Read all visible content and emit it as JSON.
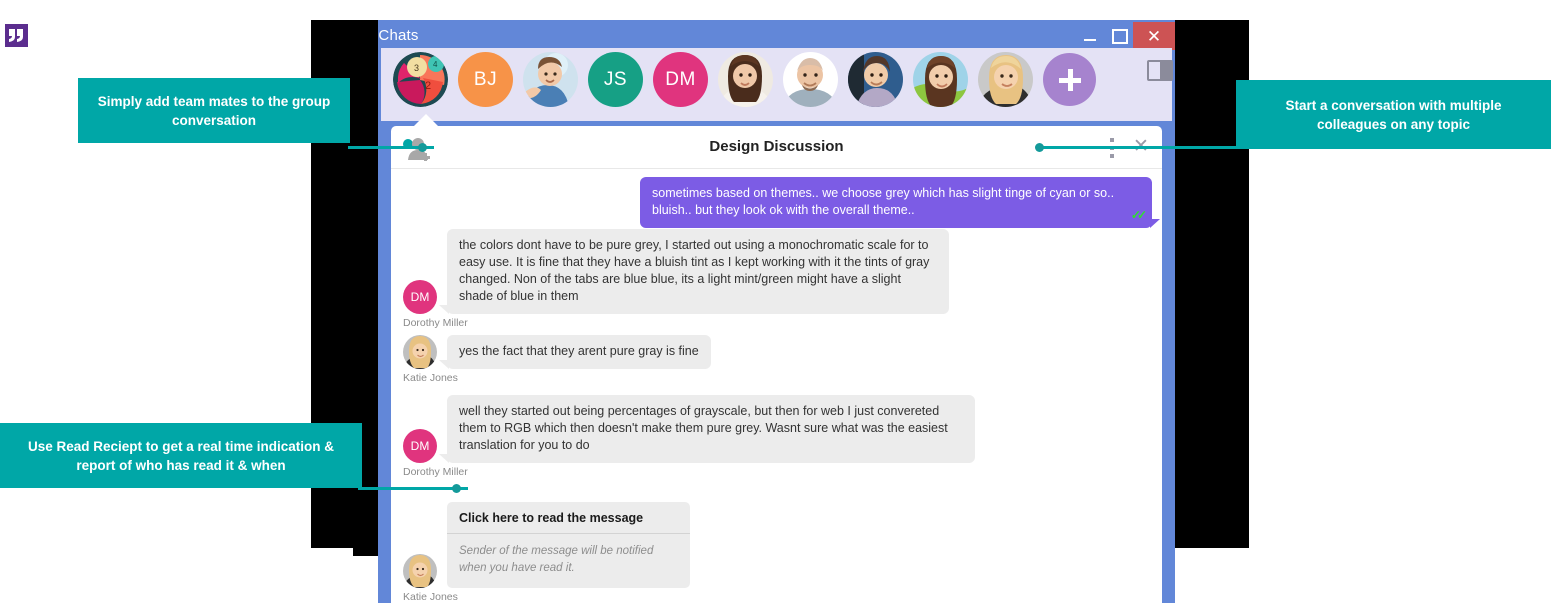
{
  "window": {
    "title": "Chats",
    "app_icon": "quote-icon",
    "controls": {
      "minimize": "–",
      "maximize": "□",
      "close": "✕"
    }
  },
  "contacts": {
    "items": [
      {
        "name": "group-avatar",
        "type": "group",
        "badges": [
          "3",
          "4",
          "2"
        ]
      },
      {
        "name": "BJ",
        "type": "initials",
        "color": "#f79348"
      },
      {
        "name": "photo-man-1",
        "type": "photo"
      },
      {
        "name": "JS",
        "type": "initials",
        "color": "#16a085"
      },
      {
        "name": "DM",
        "type": "initials",
        "color": "#e0347e"
      },
      {
        "name": "photo-woman-1",
        "type": "photo"
      },
      {
        "name": "photo-man-2",
        "type": "photo"
      },
      {
        "name": "photo-man-3",
        "type": "photo"
      },
      {
        "name": "photo-woman-2",
        "type": "photo"
      },
      {
        "name": "photo-woman-3",
        "type": "photo"
      }
    ],
    "add_button_label": "+",
    "panel_toggle": "split-panel-icon"
  },
  "conversation": {
    "title": "Design Discussion",
    "add_person_icon": "add-person-icon",
    "menu_icon": "more-vertical-icon",
    "close_icon": "close-icon",
    "messages": [
      {
        "id": "m1",
        "direction": "out",
        "text": "sometimes based on themes.. we choose grey which has slight tinge of cyan or so.. bluish.. but they look ok with the overall theme..",
        "sender": "",
        "receipt": "✓✓"
      },
      {
        "id": "m2",
        "direction": "in",
        "text": "the colors dont have to be pure grey, I started out using a monochromatic scale for to easy use. It is fine that they have a bluish tint as I kept working with it the tints of gray changed. Non of the tabs are blue blue, its a light mint/green might have a slight shade of blue in them",
        "sender": "Dorothy Miller",
        "avatar": "DM"
      },
      {
        "id": "m3",
        "direction": "in",
        "text": "yes the fact that they arent pure gray is fine",
        "sender": "Katie Jones",
        "avatar": "photo"
      },
      {
        "id": "m4",
        "direction": "in",
        "text": "well they started out being percentages of grayscale, but then for web I just convereted them to RGB which then doesn't make them pure grey. Wasnt sure what was the easiest translation for you to do",
        "sender": "Dorothy Miller",
        "avatar": "DM"
      }
    ],
    "read_receipt": {
      "title": "Click here to read the message",
      "body": "Sender of the message will be notified when you have read it.",
      "sender": "Katie Jones",
      "avatar": "photo"
    }
  },
  "callouts": {
    "top_left": "Simply add team mates to the group conversation",
    "top_right": "Start a conversation with multiple colleagues on any topic",
    "bottom_left": "Use Read Reciept to get a real time indication & report of who has read it & when"
  },
  "colors": {
    "accent_teal": "#00a7a7",
    "title_blue": "#6287d8",
    "strip_lavender": "#e4e2f5",
    "bubble_out": "#7c5ce5",
    "bubble_in": "#ececec",
    "add_purple": "#a683ce",
    "close_red": "#cd5354",
    "receipt_green": "#2ee02e"
  }
}
